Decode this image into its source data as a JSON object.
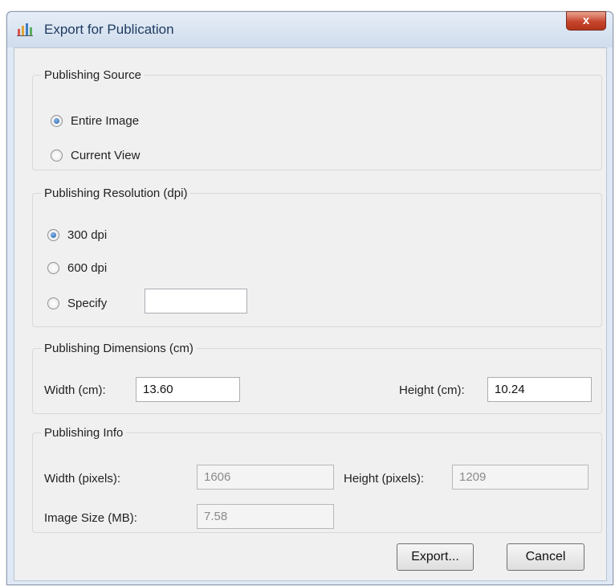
{
  "window": {
    "title": "Export for Publication",
    "icon": "chart-icon",
    "close_label": "x"
  },
  "publishing_source": {
    "legend": "Publishing Source",
    "options": [
      {
        "label": "Entire Image",
        "checked": true
      },
      {
        "label": "Current View",
        "checked": false
      }
    ]
  },
  "publishing_resolution": {
    "legend": "Publishing Resolution (dpi)",
    "options": [
      {
        "label": "300 dpi",
        "checked": true
      },
      {
        "label": "600 dpi",
        "checked": false
      },
      {
        "label": "Specify",
        "checked": false
      }
    ],
    "specify_value": ""
  },
  "publishing_dimensions": {
    "legend": "Publishing Dimensions (cm)",
    "width_label": "Width (cm):",
    "width_value": "13.60",
    "height_label": "Height (cm):",
    "height_value": "10.24"
  },
  "publishing_info": {
    "legend": "Publishing Info",
    "width_label": "Width (pixels):",
    "width_value": "1606",
    "height_label": "Height (pixels):",
    "height_value": "1209",
    "size_label": "Image Size (MB):",
    "size_value": "7.58"
  },
  "buttons": {
    "export": "Export...",
    "cancel": "Cancel"
  }
}
